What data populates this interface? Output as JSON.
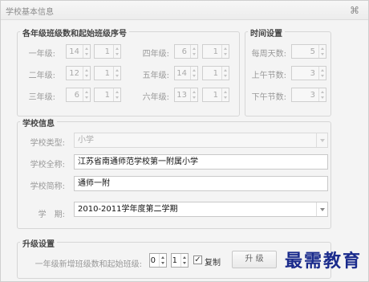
{
  "window": {
    "title": "学校基本信息",
    "close_icon": "⌘"
  },
  "grades_group": {
    "title": "各年级班级数和起始班级序号",
    "rows": [
      {
        "label": "一年级:",
        "classes": "14",
        "start": "1"
      },
      {
        "label": "二年级:",
        "classes": "12",
        "start": "1"
      },
      {
        "label": "三年级:",
        "classes": "6",
        "start": "1"
      },
      {
        "label": "四年级:",
        "classes": "6",
        "start": "1"
      },
      {
        "label": "五年级:",
        "classes": "14",
        "start": "1"
      },
      {
        "label": "六年级:",
        "classes": "13",
        "start": "1"
      }
    ]
  },
  "time_group": {
    "title": "时间设置",
    "rows": [
      {
        "label": "每周天数:",
        "value": "5"
      },
      {
        "label": "上午节数:",
        "value": "3"
      },
      {
        "label": "下午节数:",
        "value": "3"
      }
    ]
  },
  "school_group": {
    "title": "学校信息",
    "type_label": "学校类型:",
    "type_value": "小学",
    "fullname_label": "学校全称:",
    "fullname_value": "江苏省南通师范学校第一附属小学",
    "shortname_label": "学校简称:",
    "shortname_value": "通师一附",
    "term_label": "学　期:",
    "term_value": "2010-2011学年度第二学期"
  },
  "upgrade_group": {
    "title": "升级设置",
    "label": "一年级新增班级数和起始班级:",
    "new_classes": "0",
    "start_class": "1",
    "copy_label": "复制",
    "copy_checked": "✓",
    "upgrade_button": "升 级"
  },
  "watermark": "最需教育"
}
